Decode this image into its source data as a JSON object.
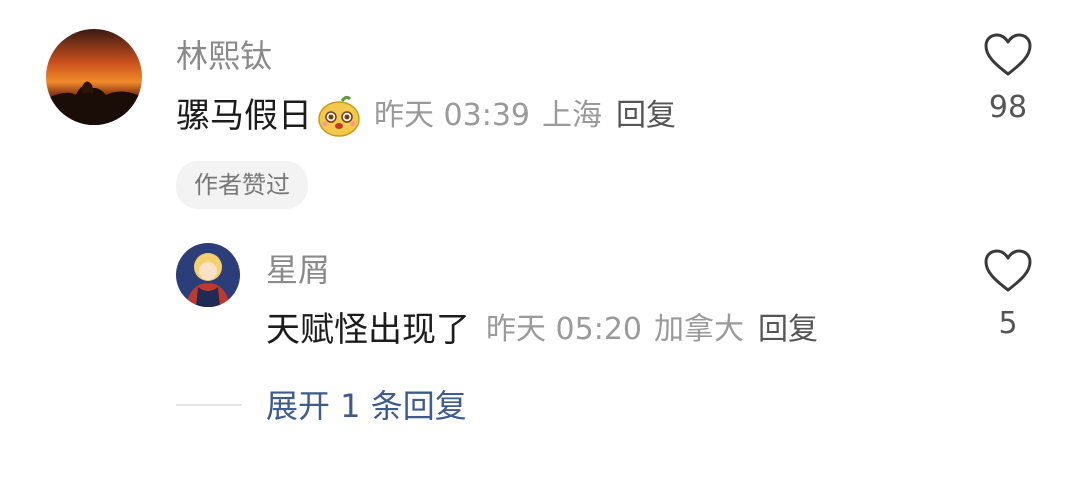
{
  "comments": [
    {
      "user": "林熙钛",
      "text": "骡马假日",
      "emoji": "smug-bean-emoji",
      "time": "昨天 03:39",
      "location": "上海",
      "reply": "回复",
      "likes": "98",
      "badge": "作者赞过"
    },
    {
      "user": "星屑",
      "text": "天赋怪出现了",
      "time": "昨天 05:20",
      "location": "加拿大",
      "reply": "回复",
      "likes": "5"
    }
  ],
  "expand": "展开 1 条回复",
  "icons": {
    "like": "heart-outline-icon"
  },
  "colors": {
    "link": "#3e5b8c",
    "muted": "#9a9a9a",
    "text": "#1c1c1c"
  }
}
